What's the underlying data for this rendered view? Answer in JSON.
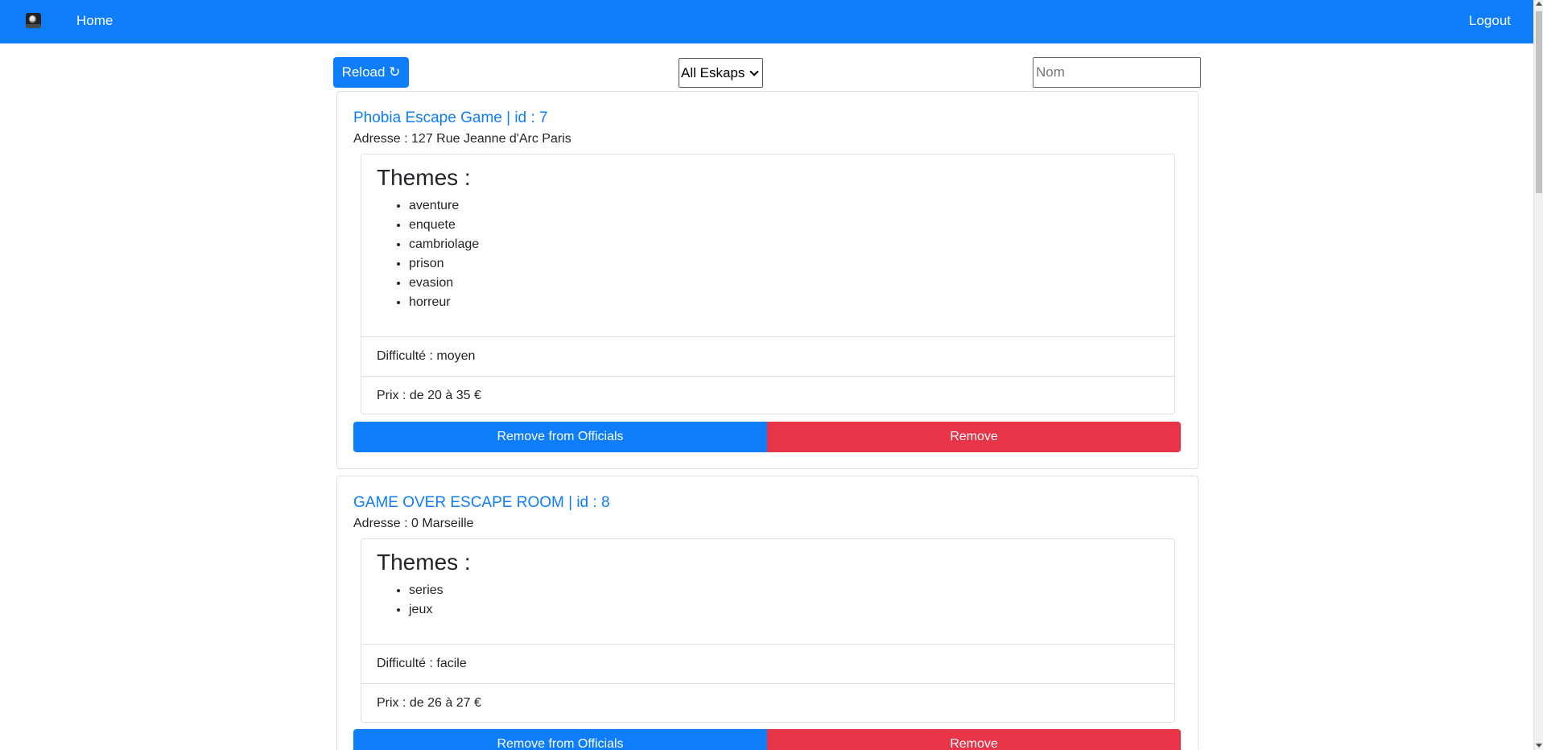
{
  "navbar": {
    "logo": "logo-icon",
    "home_label": "Home",
    "logout_label": "Logout",
    "color": "#0d7dfa"
  },
  "toolbar": {
    "reload_label": "Reload ↻",
    "filter_selected": "All Eskaps",
    "search_placeholder": "Nom",
    "search_value": ""
  },
  "labels": {
    "themes_heading": "Themes :",
    "remove_officials": "Remove from Officials",
    "remove": "Remove"
  },
  "escapes": [
    {
      "title": "Phobia Escape Game | id : 7",
      "address": "Adresse : 127 Rue Jeanne d'Arc Paris",
      "themes": [
        "aventure",
        "enquete",
        "cambriolage",
        "prison",
        "evasion",
        "horreur"
      ],
      "difficulty": "Difficulté : moyen",
      "price": "Prix : de 20 à 35 €"
    },
    {
      "title": "GAME OVER ESCAPE ROOM | id : 8",
      "address": "Adresse : 0 Marseille",
      "themes": [
        "series",
        "jeux"
      ],
      "difficulty": "Difficulté : facile",
      "price": "Prix : de 26 à 27 €"
    }
  ],
  "colors": {
    "primary": "#0d7dfa",
    "danger": "#e73446",
    "border": "#dfdfdf"
  }
}
